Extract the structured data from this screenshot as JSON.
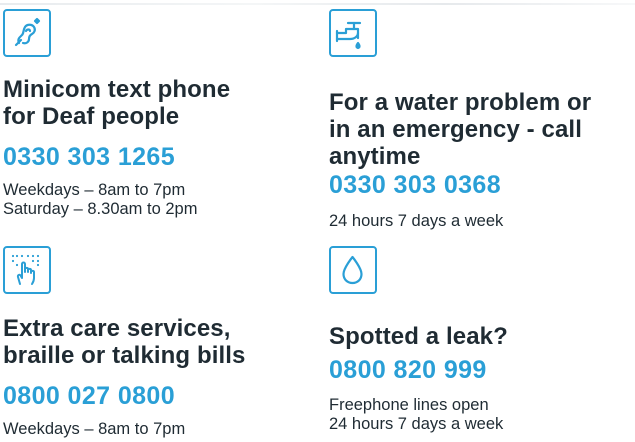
{
  "cards": [
    {
      "icon": "hearing-ear-icon",
      "heading_lines": [
        "Minicom text phone",
        "for Deaf people"
      ],
      "phone": "0330 303 1265",
      "hours": [
        "Weekdays – 8am to 7pm",
        "Saturday – 8.30am to 2pm"
      ]
    },
    {
      "icon": "water-tap-icon",
      "heading_lines": [
        "For a water problem or",
        "in an emergency - call",
        "anytime"
      ],
      "phone": "0330 303 0368",
      "hours": [
        "24 hours 7 days a week"
      ]
    },
    {
      "icon": "braille-hand-icon",
      "heading_lines": [
        "Extra care services,",
        "braille or talking bills"
      ],
      "phone": "0800 027 0800",
      "hours": [
        "Weekdays – 8am to 7pm"
      ]
    },
    {
      "icon": "water-drop-icon",
      "heading_lines": [
        "Spotted a leak?"
      ],
      "phone": "0800 820 999",
      "hours": [
        "Freephone lines open",
        "24 hours 7 days a week"
      ]
    }
  ],
  "colors": {
    "accent": "#2a9fd6",
    "text": "#1f2b33"
  }
}
